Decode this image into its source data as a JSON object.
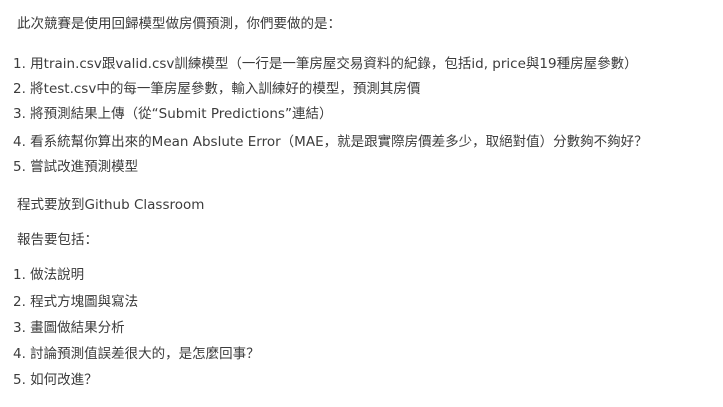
{
  "intro": "此次競賽是使用回歸模型做房價預測，你們要做的是：",
  "tasks": [
    "1. 用train.csv跟valid.csv訓練模型（一行是一筆房屋交易資料的紀錄，包括id, price與19種房屋參數）",
    "2. 將test.csv中的每一筆房屋參數，輸入訓練好的模型，預測其房價",
    "3. 將預測結果上傳（從“Submit Predictions”連結）",
    "4. 看系統幫你算出來的Mean Abslute Error（MAE，就是跟實際房價差多少，取絕對值）分數夠不夠好？",
    "5. 嘗試改進預測模型"
  ],
  "code_note": "程式要放到Github Classroom",
  "report_intro": "報告要包括：",
  "report_items": [
    "1. 做法說明",
    "2. 程式方塊圖與寫法",
    "3. 畫圖做結果分析",
    "4. 討論預測值誤差很大的，是怎麼回事？",
    "5. 如何改進？"
  ]
}
